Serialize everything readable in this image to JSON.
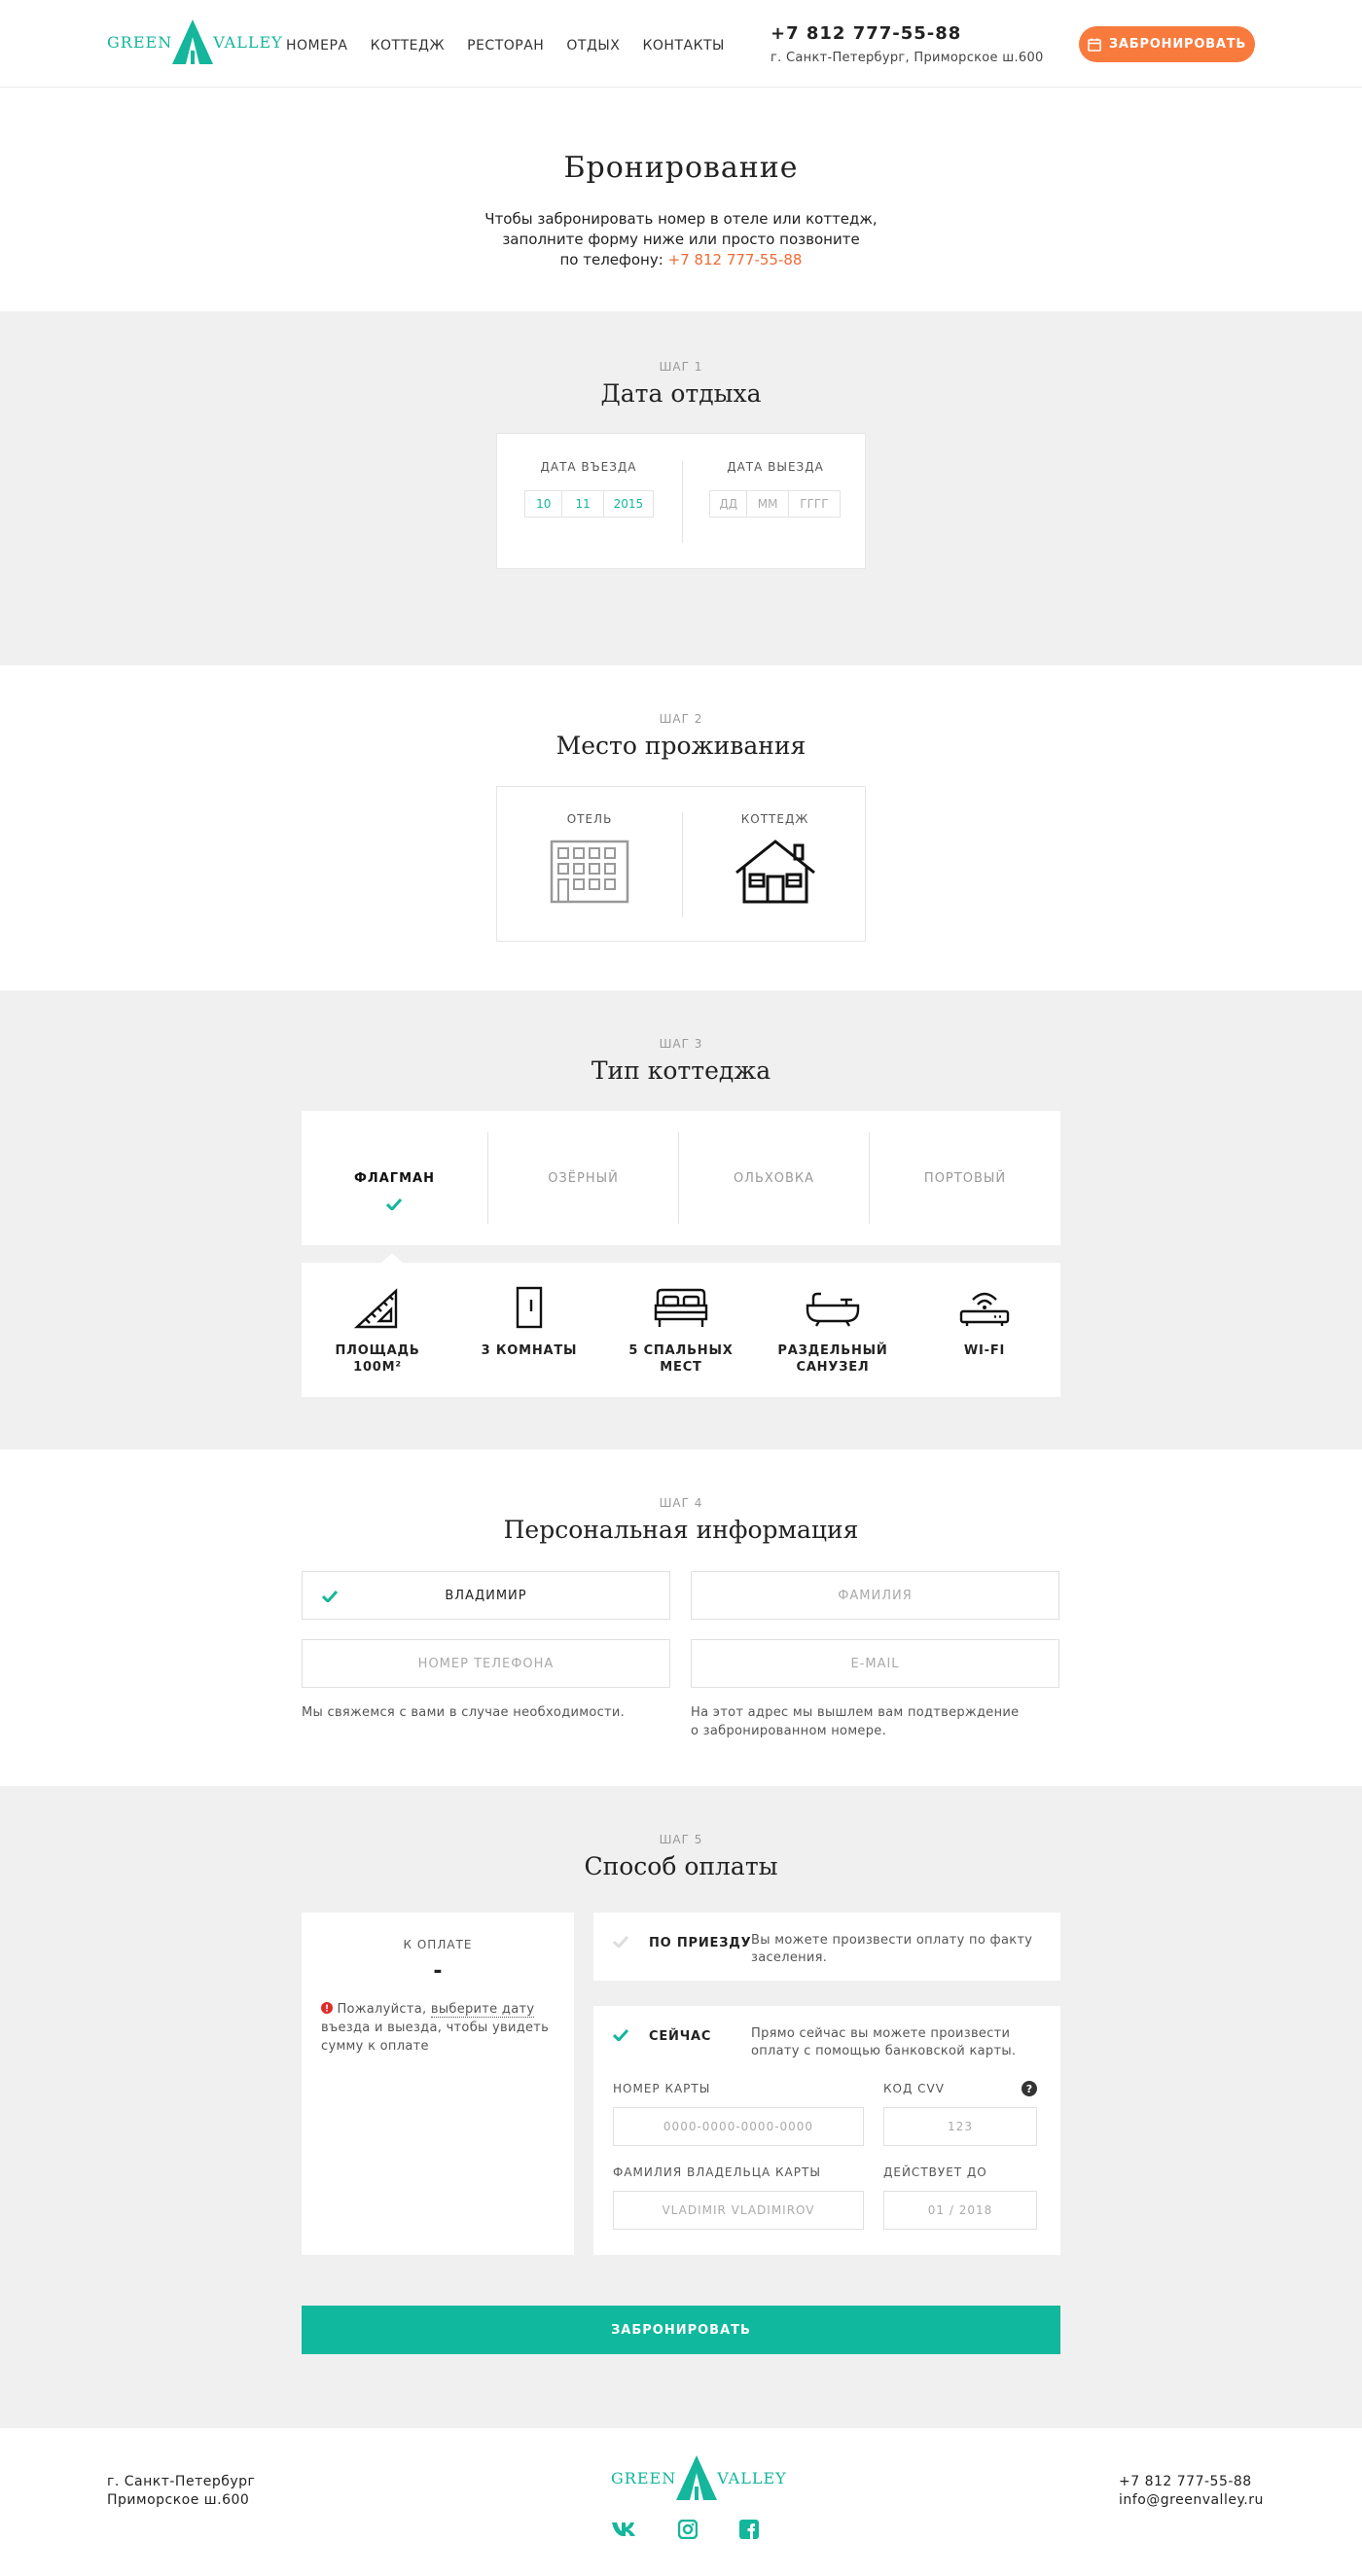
{
  "header": {
    "logo_left": "GREEN",
    "logo_right": "VALLEY",
    "nav": [
      "Номера",
      "Коттедж",
      "Ресторан",
      "Отдых",
      "Контакты"
    ],
    "phone": "+7 812 777-55-88",
    "address": "г. Санкт-Петербург, Приморское ш.600",
    "book_button": "Забронировать"
  },
  "intro": {
    "title": "Бронирование",
    "line1": "Чтобы забронировать номер в отеле или коттедж,",
    "line2": "заполните форму ниже или просто позвоните",
    "line3": "по телефону:",
    "phone": "+7 812 777-55-88"
  },
  "step1": {
    "label": "Шаг 1",
    "title": "Дата отдыха",
    "checkin_label": "Дата въезда",
    "checkin": {
      "dd": "10",
      "mm": "11",
      "yyyy": "2015"
    },
    "checkout_label": "Дата выезда",
    "checkout_placeholder": {
      "dd": "ДД",
      "mm": "ММ",
      "yyyy": "ГГГГ"
    }
  },
  "step2": {
    "label": "Шаг 2",
    "title": "Место проживания",
    "options": [
      {
        "label": "Отель",
        "icon": "hotel-building-icon"
      },
      {
        "label": "Коттедж",
        "icon": "cottage-house-icon"
      }
    ]
  },
  "step3": {
    "label": "Шаг 3",
    "title": "Тип коттеджа",
    "tabs": [
      "Флагман",
      "Озёрный",
      "Ольховка",
      "Портовый"
    ],
    "selected_tab": "Флагман",
    "features": [
      {
        "line1": "Площадь",
        "line2": "100м²",
        "icon": "ruler-triangle-icon"
      },
      {
        "line1": "3 комнаты",
        "line2": "",
        "icon": "door-icon"
      },
      {
        "line1": "5 спальных",
        "line2": "мест",
        "icon": "bed-icon"
      },
      {
        "line1": "Раздельный",
        "line2": "санузел",
        "icon": "bathtub-icon"
      },
      {
        "line1": "Wi-Fi",
        "line2": "",
        "icon": "wifi-router-icon"
      }
    ]
  },
  "step4": {
    "label": "Шаг 4",
    "title": "Персональная информация",
    "first_name_value": "Владимир",
    "last_name_placeholder": "Фамилия",
    "phone_placeholder": "Номер телефона",
    "email_placeholder": "E-mail",
    "phone_hint": "Мы свяжемся с вами в случае необходимости.",
    "email_hint1": "На этот адрес мы вышлем вам подтверждение",
    "email_hint2": "о забронированном номере."
  },
  "step5": {
    "label": "Шаг 5",
    "title": "Способ оплаты",
    "to_pay_label": "К оплате",
    "to_pay_value": "-",
    "warning_a": "Пожалуйста,",
    "warning_link": "выберите дату",
    "warning_b": "въезда и выезда, чтобы увидеть",
    "warning_c": "сумму к оплате",
    "on_arrival_label": "По приезду",
    "on_arrival_desc1": "Вы можете произвести оплату по факту",
    "on_arrival_desc2": "заселения.",
    "now_label": "Сейчас",
    "now_desc1": "Прямо сейчас вы можете произвести",
    "now_desc2": "оплату с помощью банковской карты.",
    "card_number_label": "Номер карты",
    "card_number_placeholder": "0000-0000-0000-0000",
    "cvv_label": "Код CVV",
    "cvv_placeholder": "123",
    "holder_label": "Фамилия владельца карты",
    "holder_placeholder": "VLADIMIR VLADIMIROV",
    "expiry_label": "Действует до",
    "expiry_placeholder": "01 / 2018",
    "submit": "Забронировать"
  },
  "footer": {
    "address1": "г. Санкт-Петербург",
    "address2": "Приморское ш.600",
    "phone": "+7 812 777-55-88",
    "email": "info@greenvalley.ru",
    "logo_left": "GREEN",
    "logo_right": "VALLEY",
    "social": [
      "vk-icon",
      "instagram-icon",
      "facebook-icon"
    ]
  },
  "colors": {
    "accent": "#14b69c",
    "orange": "#f97a3d",
    "gray_bg": "#f0f0f0"
  }
}
